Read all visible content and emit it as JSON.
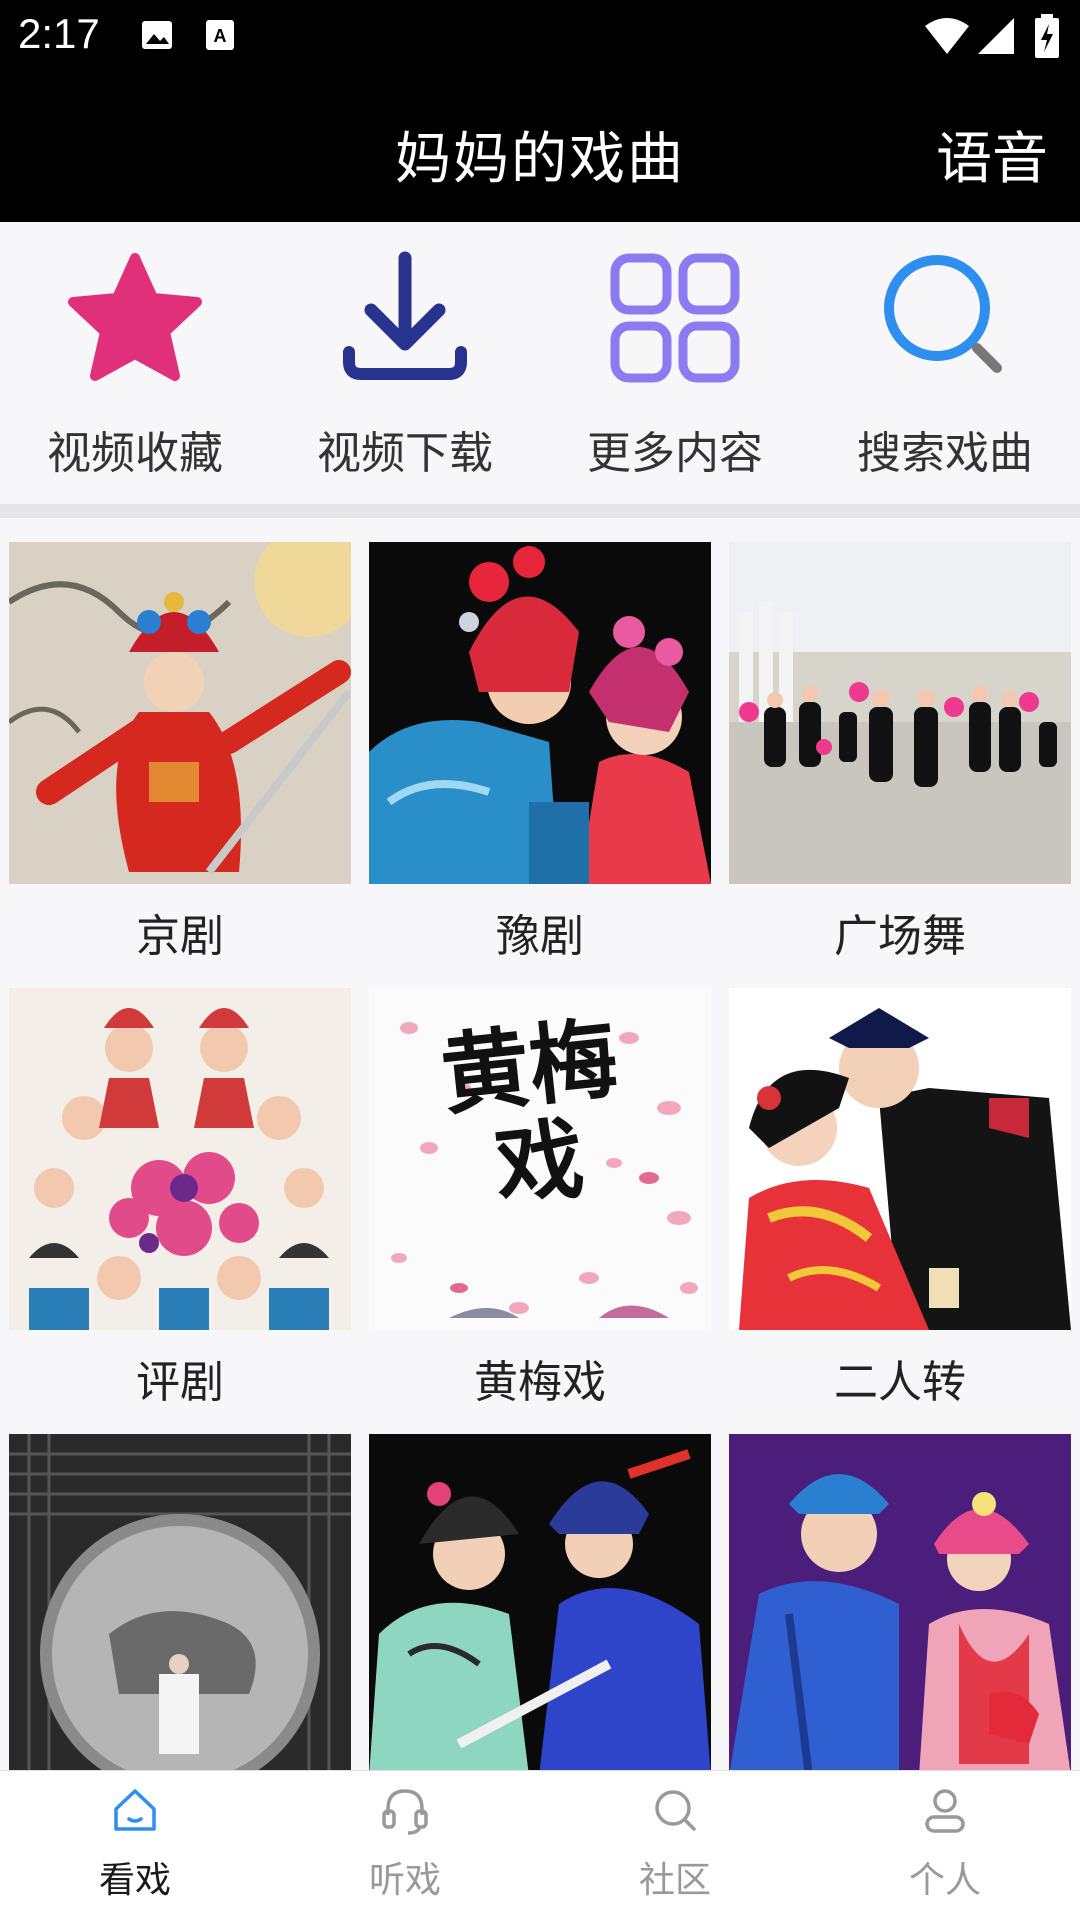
{
  "status_bar": {
    "time": "2:17"
  },
  "app_bar": {
    "title": "妈妈的戏曲",
    "voice_label": "语音"
  },
  "quick_actions": [
    {
      "label": "视频收藏",
      "icon": "star-icon",
      "color": "#e0307a"
    },
    {
      "label": "视频下载",
      "icon": "download-icon",
      "color": "#27338f"
    },
    {
      "label": "更多内容",
      "icon": "grid-icon",
      "color": "#8b7bf0"
    },
    {
      "label": "搜索戏曲",
      "icon": "search-icon",
      "color": "#2f8ff0"
    }
  ],
  "categories": [
    {
      "label": "京剧"
    },
    {
      "label": "豫剧"
    },
    {
      "label": "广场舞"
    },
    {
      "label": "评剧"
    },
    {
      "label": "黄梅戏",
      "thumb_text": "黄梅戏"
    },
    {
      "label": "二人转"
    },
    {
      "label": ""
    },
    {
      "label": ""
    },
    {
      "label": ""
    }
  ],
  "bottom_nav": [
    {
      "label": "看戏",
      "icon": "home-icon",
      "active": true
    },
    {
      "label": "听戏",
      "icon": "headphones-icon",
      "active": false
    },
    {
      "label": "社区",
      "icon": "search-icon",
      "active": false
    },
    {
      "label": "个人",
      "icon": "person-icon",
      "active": false
    }
  ],
  "colors": {
    "accent": "#2f8ff0",
    "nav_inactive": "#999999",
    "bar": "#000000"
  }
}
